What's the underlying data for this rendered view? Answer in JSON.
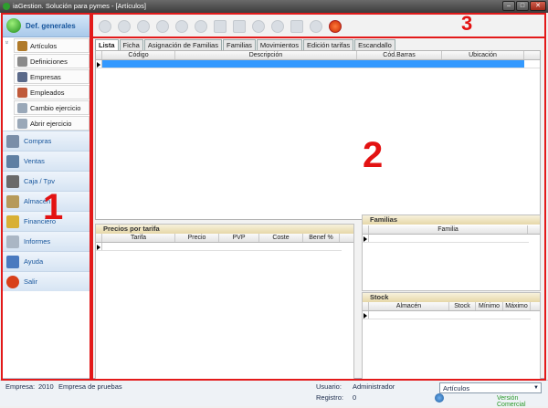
{
  "window": {
    "title": "iaGestion. Solución para pymes - [Artículos]",
    "btn_min": "–",
    "btn_max": "□",
    "btn_close": "✕"
  },
  "sidebar": {
    "header": "Def. generales",
    "collapse_glyph": "»",
    "subitems": [
      {
        "label": "Artículos",
        "icon": "box-icon",
        "color": "#b07a2a"
      },
      {
        "label": "Definiciones",
        "icon": "document-icon",
        "color": "#8a8a8a"
      },
      {
        "label": "Empresas",
        "icon": "building-icon",
        "color": "#5b6a8a"
      },
      {
        "label": "Empleados",
        "icon": "people-icon",
        "color": "#c05a3a"
      },
      {
        "label": "Cambio ejercicio",
        "icon": "document-icon",
        "color": "#9aa8b8"
      },
      {
        "label": "Abrir ejercicio",
        "icon": "document-icon",
        "color": "#9aa8b8"
      }
    ],
    "nav": [
      {
        "label": "Compras",
        "icon": "truck-icon",
        "color": "#7a8ea8"
      },
      {
        "label": "Ventas",
        "icon": "cart-icon",
        "color": "#5f7fa2"
      },
      {
        "label": "Caja / Tpv",
        "icon": "cash-register-icon",
        "color": "#6a6a6a"
      },
      {
        "label": "Almacén",
        "icon": "warehouse-icon",
        "color": "#b69a5a"
      },
      {
        "label": "Financiero",
        "icon": "coins-icon",
        "color": "#d8b035"
      },
      {
        "label": "Informes",
        "icon": "report-icon",
        "color": "#aab6c4"
      },
      {
        "label": "Ayuda",
        "icon": "help-people-icon",
        "color": "#4a7abf"
      },
      {
        "label": "Salir",
        "icon": "power-icon",
        "color": "#d8401a"
      }
    ]
  },
  "toolbar": [
    {
      "icon": "first-record-icon"
    },
    {
      "icon": "previous-record-icon"
    },
    {
      "icon": "next-record-icon"
    },
    {
      "icon": "last-record-icon"
    },
    {
      "icon": "add-icon"
    },
    {
      "icon": "delete-icon"
    },
    {
      "icon": "edit-icon"
    },
    {
      "icon": "copy-icon"
    },
    {
      "icon": "save-icon"
    },
    {
      "icon": "cancel-icon"
    },
    {
      "icon": "print-icon"
    },
    {
      "icon": "search-icon"
    },
    {
      "icon": "exit-power-icon"
    }
  ],
  "tabs": [
    "Lista",
    "Ficha",
    "Asignación de Familias",
    "Familias",
    "Movimientos",
    "Edición tarifas",
    "Escandallo"
  ],
  "main_grid": {
    "columns": [
      "Código",
      "Descripción",
      "Cód.Barras",
      "Ubicación"
    ]
  },
  "precios": {
    "title": "Precios por tarifa",
    "columns": [
      "Tarifa",
      "Precio",
      "PVP",
      "Coste",
      "Benef %"
    ]
  },
  "familias": {
    "title": "Familias",
    "columns": [
      "Familia"
    ]
  },
  "stock": {
    "title": "Stock",
    "columns": [
      "Almacén",
      "Stock",
      "Mínimo",
      "Máximo"
    ]
  },
  "status": {
    "empresa_label": "Empresa:",
    "empresa_year": "2010",
    "empresa_name": "Empresa de pruebas",
    "usuario_label": "Usuario:",
    "usuario_value": "Administrador",
    "registro_label": "Registro:",
    "registro_value": "0",
    "module_select": "Artículos",
    "version": "Versión Comercial"
  },
  "annotations": {
    "one": "1",
    "two": "2",
    "three": "3"
  },
  "colors": {
    "annotation": "#e31a1a",
    "header_blue": "#16559c",
    "selection": "#3399ff"
  }
}
